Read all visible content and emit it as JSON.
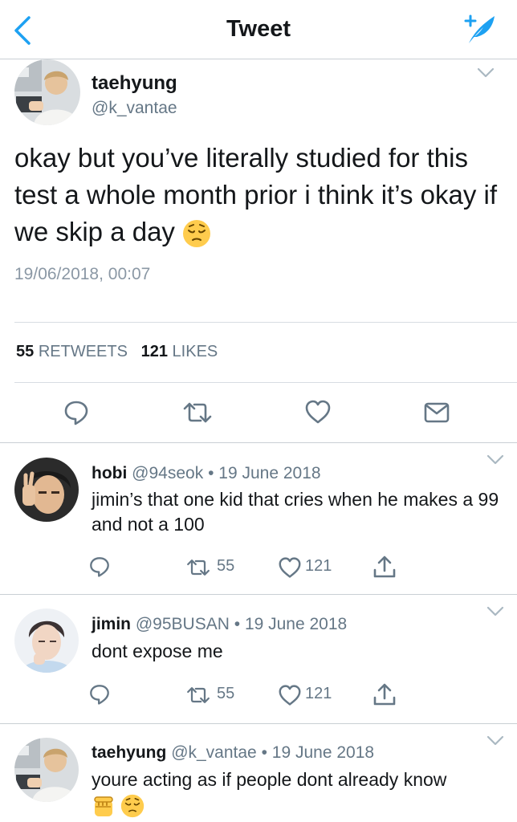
{
  "nav": {
    "title": "Tweet",
    "back_icon": "chevron-left-icon",
    "compose_icon": "compose-feather-icon",
    "accent": "#1da1f2"
  },
  "main_tweet": {
    "name": "taehyung",
    "handle": "@k_vantae",
    "text": "okay but you’ve literally studied for this test a whole month prior i think it’s okay if we skip a day",
    "emoji": "pensive-face",
    "timestamp": "19/06/2018, 00:07",
    "retweets_count": "55",
    "retweets_label": "RETWEETS",
    "likes_count": "121",
    "likes_label": "LIKES"
  },
  "replies": [
    {
      "name": "hobi",
      "handle": "@94seok",
      "separator": "•",
      "date": "19 June 2018",
      "text": "jimin’s that one kid that cries when he makes a 99 and not a 100",
      "retweets": "55",
      "likes": "121"
    },
    {
      "name": "jimin",
      "handle": "@95BUSAN",
      "separator": "•",
      "date": "19 June 2018",
      "text": "dont expose me",
      "retweets": "55",
      "likes": "121"
    },
    {
      "name": "taehyung",
      "handle": "@k_vantae",
      "separator": "•",
      "date": "19 June 2018",
      "text": "youre acting as if people dont already know",
      "emojis": [
        "raised-fist",
        "pensive-face"
      ]
    }
  ]
}
